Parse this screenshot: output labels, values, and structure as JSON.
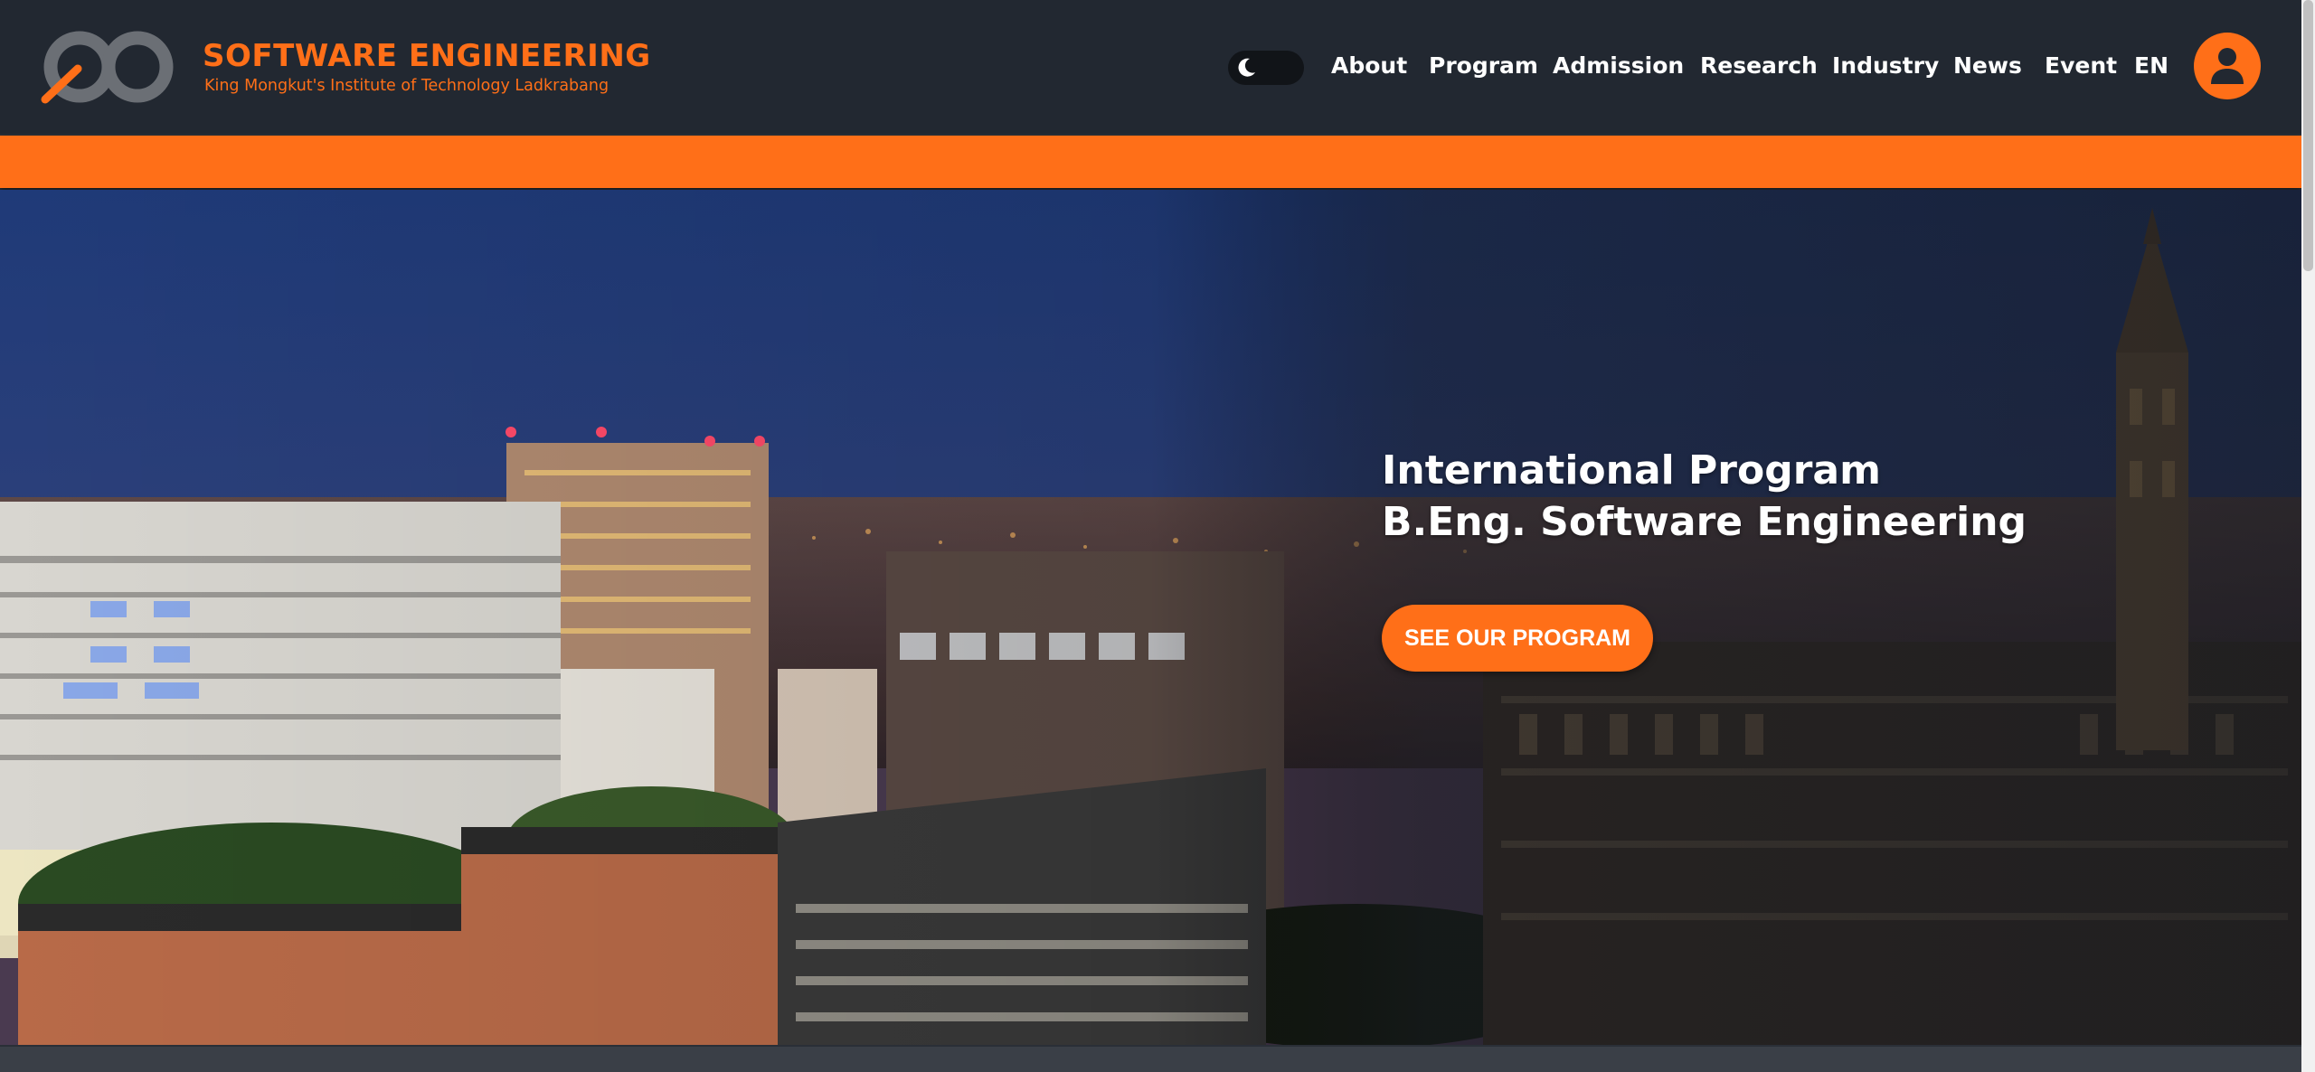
{
  "brand": {
    "title": "SOFTWARE ENGINEERING",
    "subtitle": "King Mongkut's Institute of Technology Ladkrabang",
    "logo_icon": "infinity-logo-icon"
  },
  "theme_toggle": {
    "icon": "moon-icon",
    "state": "dark"
  },
  "nav": {
    "items": [
      {
        "label": "About"
      },
      {
        "label": "Program"
      },
      {
        "label": "Admission"
      },
      {
        "label": "Research"
      },
      {
        "label": "Industry"
      },
      {
        "label": "News"
      },
      {
        "label": "Event"
      },
      {
        "label": "EN"
      }
    ]
  },
  "user": {
    "icon": "user-icon"
  },
  "hero": {
    "line1": "International Program",
    "line2": "B.Eng. Software Engineering",
    "cta_label": "SEE OUR PROGRAM"
  },
  "colors": {
    "accent": "#ff6f18",
    "header_bg": "#222831",
    "text": "#ffffff"
  }
}
